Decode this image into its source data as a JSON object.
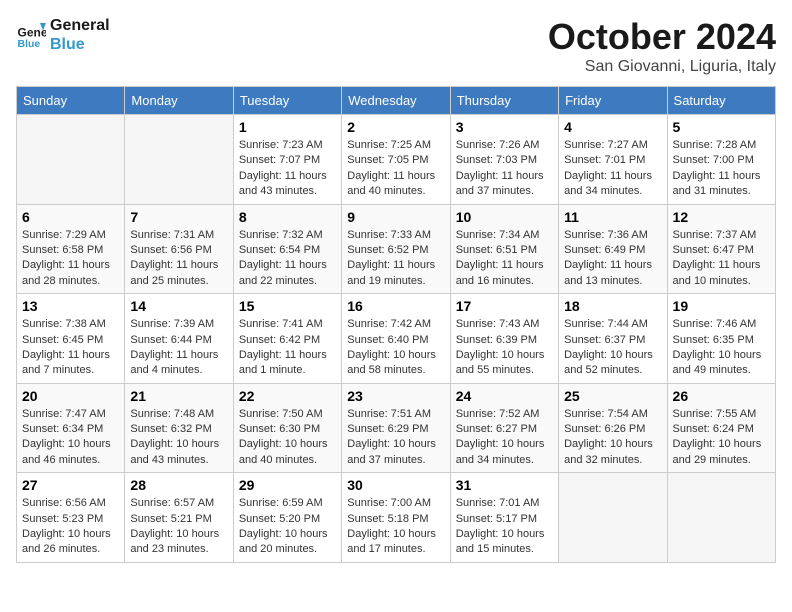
{
  "header": {
    "logo_line1": "General",
    "logo_line2": "Blue",
    "month": "October 2024",
    "location": "San Giovanni, Liguria, Italy"
  },
  "days_of_week": [
    "Sunday",
    "Monday",
    "Tuesday",
    "Wednesday",
    "Thursday",
    "Friday",
    "Saturday"
  ],
  "weeks": [
    [
      {
        "day": "",
        "empty": true
      },
      {
        "day": "",
        "empty": true
      },
      {
        "day": "1",
        "sunrise": "7:23 AM",
        "sunset": "7:07 PM",
        "daylight": "11 hours and 43 minutes."
      },
      {
        "day": "2",
        "sunrise": "7:25 AM",
        "sunset": "7:05 PM",
        "daylight": "11 hours and 40 minutes."
      },
      {
        "day": "3",
        "sunrise": "7:26 AM",
        "sunset": "7:03 PM",
        "daylight": "11 hours and 37 minutes."
      },
      {
        "day": "4",
        "sunrise": "7:27 AM",
        "sunset": "7:01 PM",
        "daylight": "11 hours and 34 minutes."
      },
      {
        "day": "5",
        "sunrise": "7:28 AM",
        "sunset": "7:00 PM",
        "daylight": "11 hours and 31 minutes."
      }
    ],
    [
      {
        "day": "6",
        "sunrise": "7:29 AM",
        "sunset": "6:58 PM",
        "daylight": "11 hours and 28 minutes."
      },
      {
        "day": "7",
        "sunrise": "7:31 AM",
        "sunset": "6:56 PM",
        "daylight": "11 hours and 25 minutes."
      },
      {
        "day": "8",
        "sunrise": "7:32 AM",
        "sunset": "6:54 PM",
        "daylight": "11 hours and 22 minutes."
      },
      {
        "day": "9",
        "sunrise": "7:33 AM",
        "sunset": "6:52 PM",
        "daylight": "11 hours and 19 minutes."
      },
      {
        "day": "10",
        "sunrise": "7:34 AM",
        "sunset": "6:51 PM",
        "daylight": "11 hours and 16 minutes."
      },
      {
        "day": "11",
        "sunrise": "7:36 AM",
        "sunset": "6:49 PM",
        "daylight": "11 hours and 13 minutes."
      },
      {
        "day": "12",
        "sunrise": "7:37 AM",
        "sunset": "6:47 PM",
        "daylight": "11 hours and 10 minutes."
      }
    ],
    [
      {
        "day": "13",
        "sunrise": "7:38 AM",
        "sunset": "6:45 PM",
        "daylight": "11 hours and 7 minutes."
      },
      {
        "day": "14",
        "sunrise": "7:39 AM",
        "sunset": "6:44 PM",
        "daylight": "11 hours and 4 minutes."
      },
      {
        "day": "15",
        "sunrise": "7:41 AM",
        "sunset": "6:42 PM",
        "daylight": "11 hours and 1 minute."
      },
      {
        "day": "16",
        "sunrise": "7:42 AM",
        "sunset": "6:40 PM",
        "daylight": "10 hours and 58 minutes."
      },
      {
        "day": "17",
        "sunrise": "7:43 AM",
        "sunset": "6:39 PM",
        "daylight": "10 hours and 55 minutes."
      },
      {
        "day": "18",
        "sunrise": "7:44 AM",
        "sunset": "6:37 PM",
        "daylight": "10 hours and 52 minutes."
      },
      {
        "day": "19",
        "sunrise": "7:46 AM",
        "sunset": "6:35 PM",
        "daylight": "10 hours and 49 minutes."
      }
    ],
    [
      {
        "day": "20",
        "sunrise": "7:47 AM",
        "sunset": "6:34 PM",
        "daylight": "10 hours and 46 minutes."
      },
      {
        "day": "21",
        "sunrise": "7:48 AM",
        "sunset": "6:32 PM",
        "daylight": "10 hours and 43 minutes."
      },
      {
        "day": "22",
        "sunrise": "7:50 AM",
        "sunset": "6:30 PM",
        "daylight": "10 hours and 40 minutes."
      },
      {
        "day": "23",
        "sunrise": "7:51 AM",
        "sunset": "6:29 PM",
        "daylight": "10 hours and 37 minutes."
      },
      {
        "day": "24",
        "sunrise": "7:52 AM",
        "sunset": "6:27 PM",
        "daylight": "10 hours and 34 minutes."
      },
      {
        "day": "25",
        "sunrise": "7:54 AM",
        "sunset": "6:26 PM",
        "daylight": "10 hours and 32 minutes."
      },
      {
        "day": "26",
        "sunrise": "7:55 AM",
        "sunset": "6:24 PM",
        "daylight": "10 hours and 29 minutes."
      }
    ],
    [
      {
        "day": "27",
        "sunrise": "6:56 AM",
        "sunset": "5:23 PM",
        "daylight": "10 hours and 26 minutes."
      },
      {
        "day": "28",
        "sunrise": "6:57 AM",
        "sunset": "5:21 PM",
        "daylight": "10 hours and 23 minutes."
      },
      {
        "day": "29",
        "sunrise": "6:59 AM",
        "sunset": "5:20 PM",
        "daylight": "10 hours and 20 minutes."
      },
      {
        "day": "30",
        "sunrise": "7:00 AM",
        "sunset": "5:18 PM",
        "daylight": "10 hours and 17 minutes."
      },
      {
        "day": "31",
        "sunrise": "7:01 AM",
        "sunset": "5:17 PM",
        "daylight": "10 hours and 15 minutes."
      },
      {
        "day": "",
        "empty": true
      },
      {
        "day": "",
        "empty": true
      }
    ]
  ]
}
